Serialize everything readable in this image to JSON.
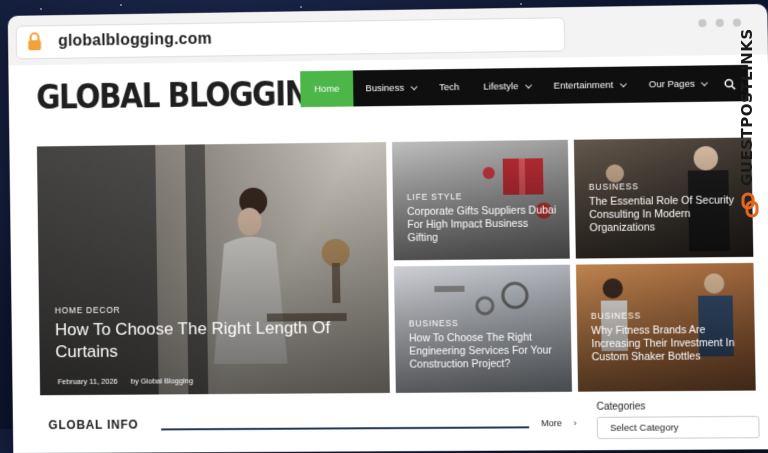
{
  "browser": {
    "url": "globalblogging.com"
  },
  "site": {
    "logo_text": "GLOBAL BLOGGING",
    "brand_color": "#4cb648",
    "nav": [
      {
        "label": "Home",
        "active": true,
        "dropdown": false
      },
      {
        "label": "Business",
        "active": false,
        "dropdown": true
      },
      {
        "label": "Tech",
        "active": false,
        "dropdown": false
      },
      {
        "label": "Lifestyle",
        "active": false,
        "dropdown": true
      },
      {
        "label": "Entertainment",
        "active": false,
        "dropdown": true
      },
      {
        "label": "Our Pages",
        "active": false,
        "dropdown": true
      }
    ]
  },
  "featured": {
    "main": {
      "category": "HOME DECOR",
      "title": "How To Choose The Right Length Of Curtains",
      "date": "February 11, 2026",
      "author": "by Global Blogging"
    },
    "cards": [
      {
        "category": "LIFE STYLE",
        "title": "Corporate Gifts Suppliers Dubai For High Impact Business Gifting"
      },
      {
        "category": "BUSINESS",
        "title": "The Essential Role Of Security Consulting In Modern Organizations"
      },
      {
        "category": "BUSINESS",
        "title": "How To Choose The Right Engineering Services For Your Construction Project?"
      },
      {
        "category": "BUSINESS",
        "title": "Why Fitness Brands Are Increasing Their Investment In Custom Shaker Bottles"
      }
    ]
  },
  "section": {
    "title": "GLOBAL INFO",
    "more": "More"
  },
  "sidebar": {
    "categories_label": "Categories",
    "categories_value": "Select Category"
  },
  "watermark": "GUESTPOSTLINKS"
}
